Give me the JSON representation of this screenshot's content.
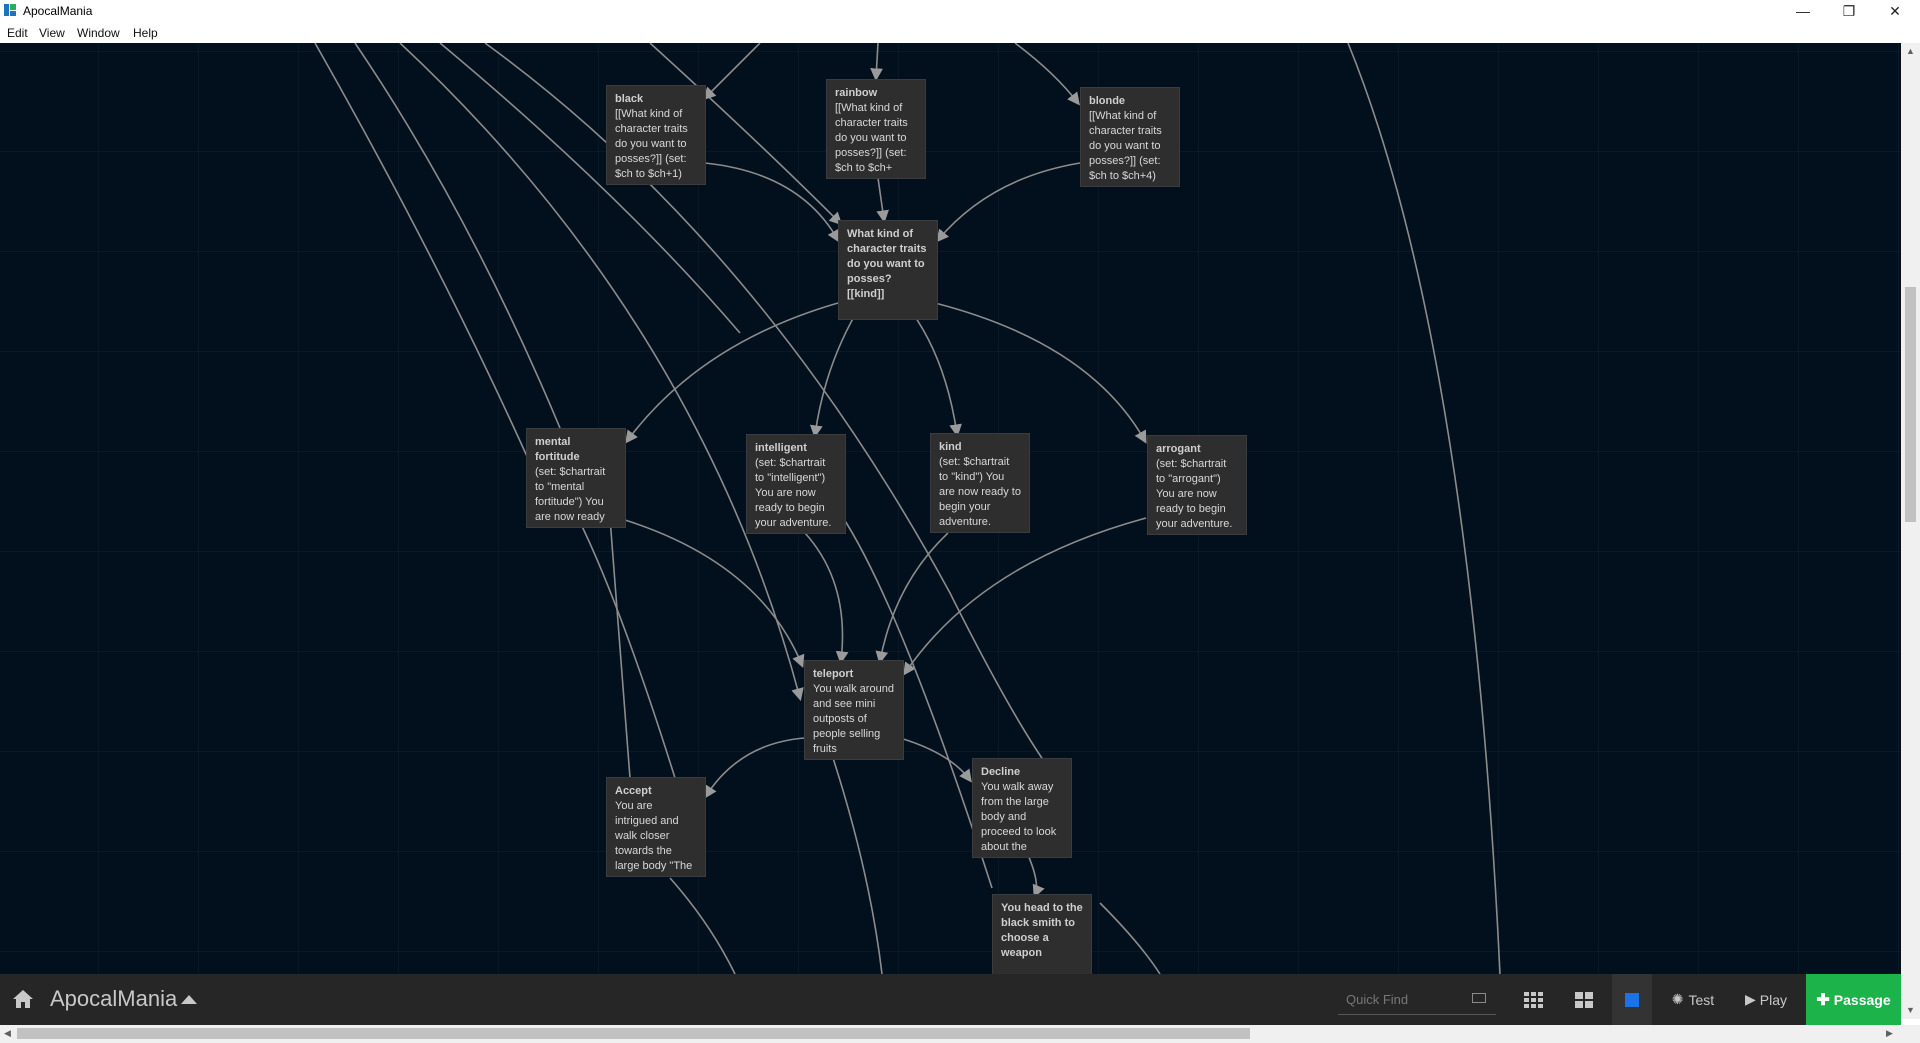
{
  "window": {
    "title": "ApocalMania",
    "minimize_glyph": "—",
    "restore_glyph": "❐",
    "close_glyph": "✕"
  },
  "menu": {
    "items": [
      "Edit",
      "View",
      "Window",
      "Help"
    ]
  },
  "passages": [
    {
      "title": "black",
      "body": "[[What kind of character traits do you want to posses?]] (set: $ch to $ch+1)"
    },
    {
      "title": "rainbow",
      "body": "[[What kind of character traits do you want to posses?]] (set: $ch to $ch+"
    },
    {
      "title": "blonde",
      "body": "[[What kind of character traits do you want to posses?]] (set: $ch to $ch+4)"
    },
    {
      "title": "What kind of character traits do you want to posses? [[kind]]",
      "body": ""
    },
    {
      "title": "mental fortitude",
      "body": "(set: $chartrait to \"mental fortitude\") You are now ready"
    },
    {
      "title": "intelligent",
      "body": "(set: $chartrait to \"intelligent\") You are now ready to begin your adventure."
    },
    {
      "title": "kind",
      "body": "(set: $chartrait to \"kind\") You are now ready to begin your adventure."
    },
    {
      "title": "arrogant",
      "body": "(set: $chartrait to \"arrogant\") You are now ready to begin your adventure."
    },
    {
      "title": "teleport",
      "body": "You walk around and see mini outposts of people selling fruits"
    },
    {
      "title": "Accept",
      "body": "You are intrigued and walk closer towards the large body \"The"
    },
    {
      "title": "Decline",
      "body": "You walk away from the large body and proceed to look about the"
    },
    {
      "title": "You head to the black smith to choose a weapon",
      "body": ""
    }
  ],
  "toolbar": {
    "story_title": "ApocalMania",
    "quick_find_placeholder": "Quick Find",
    "test_label": "Test",
    "play_label": "Play",
    "passage_label": "Passage",
    "passage_color": "#1cb34a",
    "highlight_color": "#1a73e8"
  },
  "icons": {
    "home": "home-icon",
    "story_menu": "caret-up-icon",
    "quick_find_option": "highlight-filter-icon",
    "zoom_small": "grid-small-icon",
    "zoom_medium": "grid-medium-icon",
    "zoom_large": "square-icon",
    "test": "bug-icon",
    "play": "play-icon",
    "add": "plus-icon"
  }
}
